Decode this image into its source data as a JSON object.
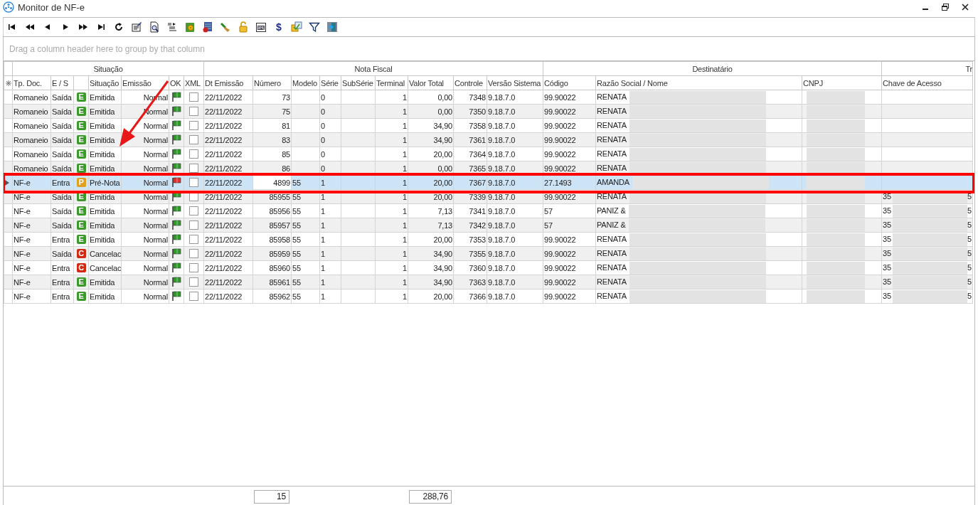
{
  "window": {
    "title": "Monitor de NF-e"
  },
  "toolbar": [
    {
      "kind": "first"
    },
    {
      "kind": "prev-page"
    },
    {
      "kind": "prev"
    },
    {
      "kind": "next"
    },
    {
      "kind": "next-page"
    },
    {
      "kind": "last"
    },
    {
      "kind": "refresh"
    },
    {
      "kind": "form"
    },
    {
      "kind": "preview"
    },
    {
      "kind": "export"
    },
    {
      "kind": "gear"
    },
    {
      "kind": "database"
    },
    {
      "kind": "brush"
    },
    {
      "kind": "lock"
    },
    {
      "kind": "xml"
    },
    {
      "kind": "text",
      "label": "$"
    },
    {
      "kind": "folders"
    },
    {
      "kind": "filter"
    },
    {
      "kind": "exit"
    }
  ],
  "group_panel": {
    "placeholder": "Drag a column header here to group by that column"
  },
  "bands": [
    "Situação",
    "Nota Fiscal",
    "Destinatário",
    "Tr"
  ],
  "columns": [
    "Tp. Doc.",
    "E / S",
    "",
    "Situação",
    "Emissão",
    "OK",
    "XML",
    "Dt Emissão",
    "Número",
    "Modelo",
    "Série",
    "SubSérie",
    "Terminal",
    "Valor Total",
    "Controle",
    "Versão Sistema",
    "Código",
    "Razão Social / Nome",
    "CNPJ",
    "Chave de Acesso"
  ],
  "rows": [
    {
      "selected": false,
      "tp": "Romaneio",
      "es": "Saída",
      "badge": "E",
      "color": "#3c9a2a",
      "situacao": "Emitida",
      "emissao": "Normal",
      "ok": true,
      "xml": false,
      "dt": "22/11/2022",
      "numero": "73",
      "modelo": "",
      "serie": "0",
      "terminal": "1",
      "valor": "0,00",
      "controle": "7348",
      "versao": "9.18.7.0",
      "codigo": "99.90022",
      "nome": "RENATA",
      "chave": "",
      "chave_tail": ""
    },
    {
      "selected": false,
      "tp": "Romaneio",
      "es": "Saída",
      "badge": "E",
      "color": "#3c9a2a",
      "situacao": "Emitida",
      "emissao": "Normal",
      "ok": true,
      "xml": false,
      "dt": "22/11/2022",
      "numero": "75",
      "modelo": "",
      "serie": "0",
      "terminal": "1",
      "valor": "0,00",
      "controle": "7350",
      "versao": "9.18.7.0",
      "codigo": "99.90022",
      "nome": "RENATA",
      "chave": "",
      "chave_tail": ""
    },
    {
      "selected": false,
      "tp": "Romaneio",
      "es": "Saída",
      "badge": "E",
      "color": "#3c9a2a",
      "situacao": "Emitida",
      "emissao": "Normal",
      "ok": true,
      "xml": false,
      "dt": "22/11/2022",
      "numero": "81",
      "modelo": "",
      "serie": "0",
      "terminal": "1",
      "valor": "34,90",
      "controle": "7358",
      "versao": "9.18.7.0",
      "codigo": "99.90022",
      "nome": "RENATA",
      "chave": "",
      "chave_tail": ""
    },
    {
      "selected": false,
      "tp": "Romaneio",
      "es": "Saída",
      "badge": "E",
      "color": "#3c9a2a",
      "situacao": "Emitida",
      "emissao": "Normal",
      "ok": true,
      "xml": false,
      "dt": "22/11/2022",
      "numero": "83",
      "modelo": "",
      "serie": "0",
      "terminal": "1",
      "valor": "34,90",
      "controle": "7361",
      "versao": "9.18.7.0",
      "codigo": "99.90022",
      "nome": "RENATA",
      "chave": "",
      "chave_tail": ""
    },
    {
      "selected": false,
      "tp": "Romaneio",
      "es": "Saída",
      "badge": "E",
      "color": "#3c9a2a",
      "situacao": "Emitida",
      "emissao": "Normal",
      "ok": true,
      "xml": false,
      "dt": "22/11/2022",
      "numero": "85",
      "modelo": "",
      "serie": "0",
      "terminal": "1",
      "valor": "20,00",
      "controle": "7364",
      "versao": "9.18.7.0",
      "codigo": "99.90022",
      "nome": "RENATA",
      "chave": "",
      "chave_tail": ""
    },
    {
      "selected": false,
      "tp": "Romaneio",
      "es": "Saída",
      "badge": "E",
      "color": "#3c9a2a",
      "situacao": "Emitida",
      "emissao": "Normal",
      "ok": true,
      "xml": false,
      "dt": "22/11/2022",
      "numero": "86",
      "modelo": "",
      "serie": "0",
      "terminal": "1",
      "valor": "0,00",
      "controle": "7365",
      "versao": "9.18.7.0",
      "codigo": "99.90022",
      "nome": "RENATA",
      "chave": "",
      "chave_tail": ""
    },
    {
      "selected": true,
      "tp": "NF-e",
      "es": "Entra",
      "badge": "P",
      "color": "#e0a020",
      "situacao": "Pré-Nota",
      "emissao": "Normal",
      "ok": false,
      "xml": false,
      "dt": "22/11/2022",
      "numero": "4899",
      "modelo": "55",
      "serie": "1",
      "terminal": "1",
      "valor": "20,00",
      "controle": "7367",
      "versao": "9.18.7.0",
      "codigo": "27.1493",
      "nome": "AMANDA",
      "chave": "",
      "chave_tail": ""
    },
    {
      "selected": false,
      "tp": "NF-e",
      "es": "Saída",
      "badge": "E",
      "color": "#3c9a2a",
      "situacao": "Emitida",
      "emissao": "Normal",
      "ok": true,
      "xml": false,
      "dt": "22/11/2022",
      "numero": "85955",
      "modelo": "55",
      "serie": "1",
      "terminal": "1",
      "valor": "20,00",
      "controle": "7339",
      "versao": "9.18.7.0",
      "codigo": "99.90022",
      "nome": "RENATA",
      "chave": "35",
      "chave_tail": "5"
    },
    {
      "selected": false,
      "tp": "NF-e",
      "es": "Saída",
      "badge": "E",
      "color": "#3c9a2a",
      "situacao": "Emitida",
      "emissao": "Normal",
      "ok": true,
      "xml": false,
      "dt": "22/11/2022",
      "numero": "85956",
      "modelo": "55",
      "serie": "1",
      "terminal": "1",
      "valor": "7,13",
      "controle": "7341",
      "versao": "9.18.7.0",
      "codigo": "57",
      "nome": "PANIZ &",
      "chave": "35",
      "chave_tail": "5"
    },
    {
      "selected": false,
      "tp": "NF-e",
      "es": "Saída",
      "badge": "E",
      "color": "#3c9a2a",
      "situacao": "Emitida",
      "emissao": "Normal",
      "ok": true,
      "xml": false,
      "dt": "22/11/2022",
      "numero": "85957",
      "modelo": "55",
      "serie": "1",
      "terminal": "1",
      "valor": "7,13",
      "controle": "7342",
      "versao": "9.18.7.0",
      "codigo": "57",
      "nome": "PANIZ &",
      "chave": "35",
      "chave_tail": "5"
    },
    {
      "selected": false,
      "tp": "NF-e",
      "es": "Entra",
      "badge": "E",
      "color": "#3c9a2a",
      "situacao": "Emitida",
      "emissao": "Normal",
      "ok": true,
      "xml": false,
      "dt": "22/11/2022",
      "numero": "85958",
      "modelo": "55",
      "serie": "1",
      "terminal": "1",
      "valor": "20,00",
      "controle": "7353",
      "versao": "9.18.7.0",
      "codigo": "99.90022",
      "nome": "RENATA",
      "chave": "35",
      "chave_tail": "5"
    },
    {
      "selected": false,
      "tp": "NF-e",
      "es": "Saída",
      "badge": "C",
      "color": "#d22a12",
      "situacao": "Cancelac",
      "emissao": "Normal",
      "ok": true,
      "xml": false,
      "dt": "22/11/2022",
      "numero": "85959",
      "modelo": "55",
      "serie": "1",
      "terminal": "1",
      "valor": "34,90",
      "controle": "7355",
      "versao": "9.18.7.0",
      "codigo": "99.90022",
      "nome": "RENATA",
      "chave": "35",
      "chave_tail": "5"
    },
    {
      "selected": false,
      "tp": "NF-e",
      "es": "Entra",
      "badge": "C",
      "color": "#d22a12",
      "situacao": "Cancelac",
      "emissao": "Normal",
      "ok": true,
      "xml": false,
      "dt": "22/11/2022",
      "numero": "85960",
      "modelo": "55",
      "serie": "1",
      "terminal": "1",
      "valor": "34,90",
      "controle": "7360",
      "versao": "9.18.7.0",
      "codigo": "99.90022",
      "nome": "RENATA",
      "chave": "35",
      "chave_tail": "5"
    },
    {
      "selected": false,
      "tp": "NF-e",
      "es": "Entra",
      "badge": "E",
      "color": "#3c9a2a",
      "situacao": "Emitida",
      "emissao": "Normal",
      "ok": true,
      "xml": false,
      "dt": "22/11/2022",
      "numero": "85961",
      "modelo": "55",
      "serie": "1",
      "terminal": "1",
      "valor": "34,90",
      "controle": "7363",
      "versao": "9.18.7.0",
      "codigo": "99.90022",
      "nome": "RENATA",
      "chave": "35",
      "chave_tail": "5"
    },
    {
      "selected": false,
      "tp": "NF-e",
      "es": "Entra",
      "badge": "E",
      "color": "#3c9a2a",
      "situacao": "Emitida",
      "emissao": "Normal",
      "ok": true,
      "xml": false,
      "dt": "22/11/2022",
      "numero": "85962",
      "modelo": "55",
      "serie": "1",
      "terminal": "1",
      "valor": "20,00",
      "controle": "7366",
      "versao": "9.18.7.0",
      "codigo": "99.90022",
      "nome": "RENATA",
      "chave": "35",
      "chave_tail": "5"
    }
  ],
  "summary": {
    "count": "15",
    "total": "288,76"
  },
  "annotation": {
    "arrow": true,
    "highlight_selected_row": true
  }
}
